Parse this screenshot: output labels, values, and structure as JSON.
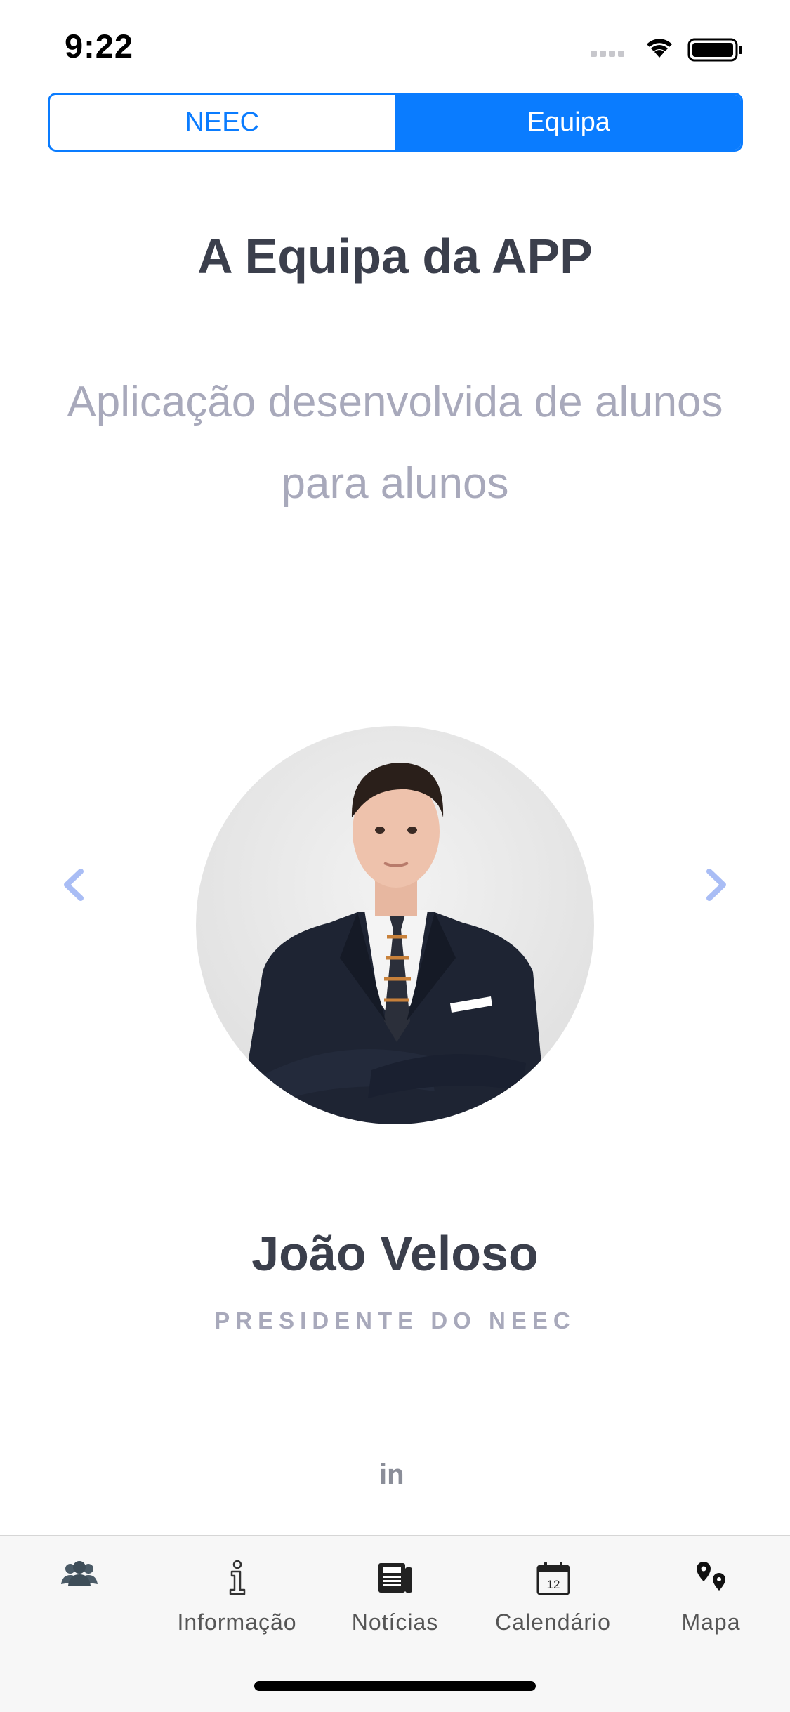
{
  "status": {
    "time": "9:22"
  },
  "segments": {
    "left": "NEEC",
    "right": "Equipa"
  },
  "page": {
    "title": "A Equipa da APP",
    "subtitle_line1": "Aplicação desenvolvida de alunos",
    "subtitle_line2": "para alunos"
  },
  "member": {
    "name": "João Veloso",
    "role": "PRESIDENTE DO NEEC",
    "social": "in"
  },
  "tabs": [
    {
      "label": "",
      "icon": "people-icon",
      "active": true
    },
    {
      "label": "Informação",
      "icon": "info-icon"
    },
    {
      "label": "Notícias",
      "icon": "newspaper-icon"
    },
    {
      "label": "Calendário",
      "icon": "calendar-icon",
      "calendar_day": "12"
    },
    {
      "label": "Mapa",
      "icon": "map-pin-icon"
    }
  ],
  "colors": {
    "accent": "#0a7cff",
    "heading": "#3b3f4c",
    "muted": "#a8a9bb",
    "arrow": "#a9bdf5"
  }
}
